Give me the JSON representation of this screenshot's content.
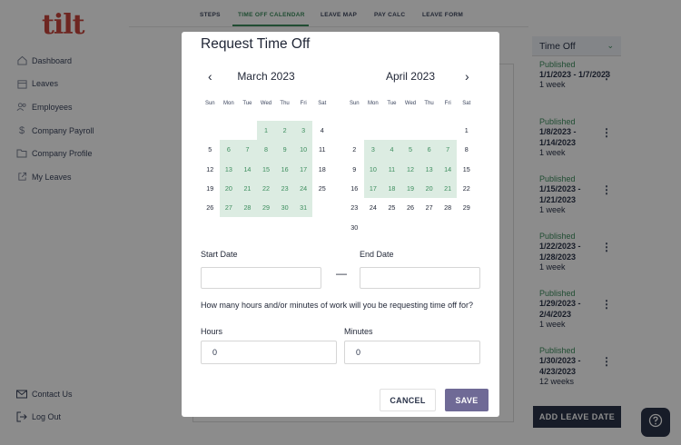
{
  "app": {
    "logo": "tilt",
    "nav": [
      {
        "label": "Dashboard",
        "icon": "home-icon"
      },
      {
        "label": "Leaves",
        "icon": "calendar-icon"
      },
      {
        "label": "Employees",
        "icon": "people-icon"
      },
      {
        "label": "Company Payroll",
        "icon": "dollar-icon"
      },
      {
        "label": "Company Profile",
        "icon": "folder-icon"
      },
      {
        "label": "My Leaves",
        "icon": "external-link-icon"
      }
    ],
    "nav_bottom": [
      {
        "label": "Contact Us",
        "icon": "mail-icon"
      },
      {
        "label": "Log Out",
        "icon": "logout-icon"
      }
    ],
    "tabs": [
      "STEPS",
      "TIME OFF CALENDAR",
      "LEAVE MAP",
      "PAY CALC",
      "LEAVE FORM"
    ],
    "active_tab": "TIME OFF CALENDAR",
    "time_off_panel": {
      "title": "Time Off",
      "items": [
        {
          "status": "Published",
          "range": "1/1/2023 - 1/7/2023",
          "duration": "1 week"
        },
        {
          "status": "Published",
          "range": "1/8/2023 - 1/14/2023",
          "duration": "1 week"
        },
        {
          "status": "Published",
          "range": "1/15/2023 - 1/21/2023",
          "duration": "1 week"
        },
        {
          "status": "Published",
          "range": "1/22/2023 - 1/28/2023",
          "duration": "1 week"
        },
        {
          "status": "Published",
          "range": "1/29/2023 - 2/4/2023",
          "duration": "1 week"
        },
        {
          "status": "Published",
          "range": "1/30/2023 - 4/23/2023",
          "duration": "12 weeks"
        }
      ]
    },
    "add_leave_label": "ADD LEAVE DATE"
  },
  "modal": {
    "title": "Request Time Off",
    "weekday_labels": [
      "Sun",
      "Mon",
      "Tue",
      "Wed",
      "Thu",
      "Fri",
      "Sat"
    ],
    "calendars": [
      {
        "month": "March 2023",
        "weeks": [
          [
            "",
            "",
            "",
            "1",
            "2",
            "3",
            "4"
          ],
          [
            "5",
            "6",
            "7",
            "8",
            "9",
            "10",
            "11"
          ],
          [
            "12",
            "13",
            "14",
            "15",
            "16",
            "17",
            "18"
          ],
          [
            "19",
            "20",
            "21",
            "22",
            "23",
            "24",
            "25"
          ],
          [
            "26",
            "27",
            "28",
            "29",
            "30",
            "31",
            ""
          ]
        ],
        "selected": [
          "1",
          "2",
          "3",
          "6",
          "7",
          "8",
          "9",
          "10",
          "13",
          "14",
          "15",
          "16",
          "17",
          "20",
          "21",
          "22",
          "23",
          "24",
          "27",
          "28",
          "29",
          "30",
          "31"
        ]
      },
      {
        "month": "April 2023",
        "weeks": [
          [
            "",
            "",
            "",
            "",
            "",
            "",
            "1"
          ],
          [
            "2",
            "3",
            "4",
            "5",
            "6",
            "7",
            "8"
          ],
          [
            "9",
            "10",
            "11",
            "12",
            "13",
            "14",
            "15"
          ],
          [
            "16",
            "17",
            "18",
            "19",
            "20",
            "21",
            "22"
          ],
          [
            "23",
            "24",
            "25",
            "26",
            "27",
            "28",
            "29"
          ],
          [
            "30",
            "",
            "",
            "",
            "",
            "",
            ""
          ]
        ],
        "selected": [
          "3",
          "4",
          "5",
          "6",
          "7",
          "10",
          "11",
          "12",
          "13",
          "14",
          "17",
          "18",
          "19",
          "20",
          "21"
        ]
      }
    ],
    "start_date_label": "Start Date",
    "start_date_value": "",
    "end_date_label": "End Date",
    "end_date_value": "",
    "range_separator": "—",
    "question": "How many hours and/or minutes of work will you be requesting time off for?",
    "hours_label": "Hours",
    "hours_value": "0",
    "minutes_label": "Minutes",
    "minutes_value": "0",
    "cancel_label": "CANCEL",
    "save_label": "SAVE"
  }
}
